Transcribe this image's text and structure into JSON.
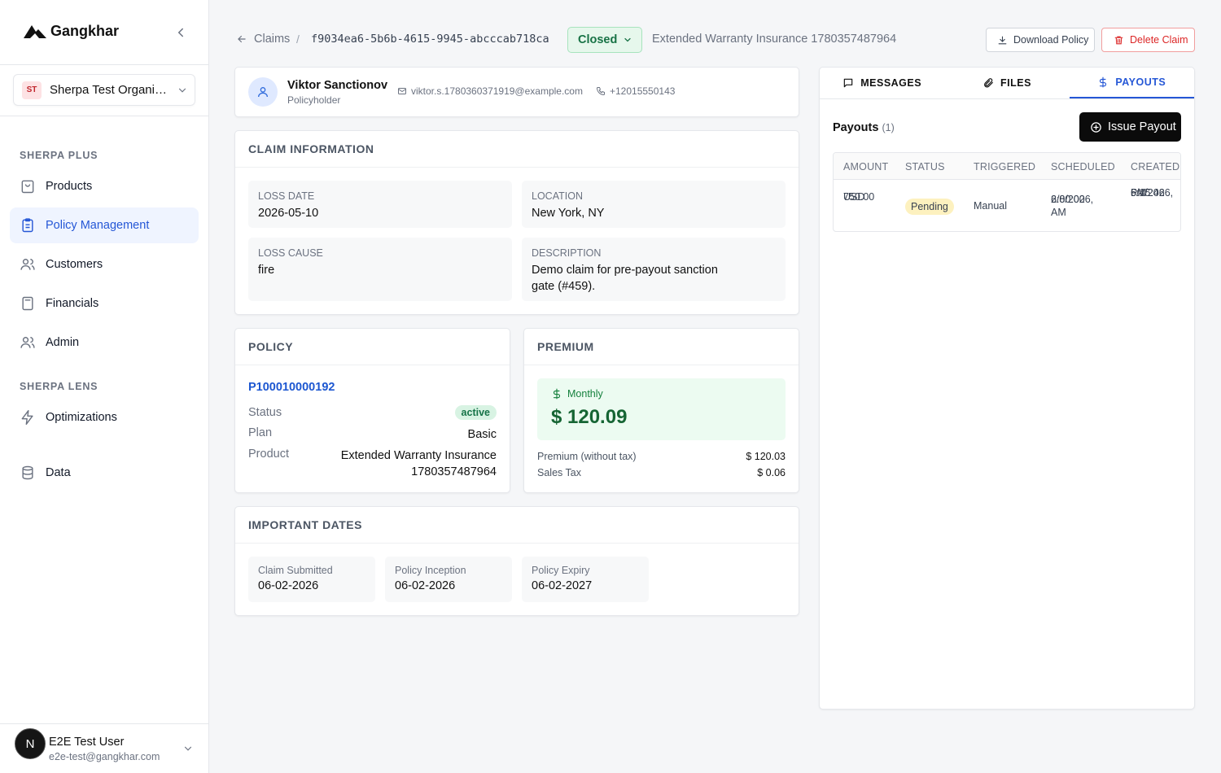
{
  "app": {
    "name": "Gangkhar"
  },
  "sidebar": {
    "org": {
      "initials": "ST",
      "name": "Sherpa Test Organization"
    },
    "sections": [
      {
        "title": "SHERPA PLUS"
      },
      {
        "title": "SHERPA LENS"
      }
    ],
    "items": [
      {
        "label": "Products"
      },
      {
        "label": "Policy Management"
      },
      {
        "label": "Customers"
      },
      {
        "label": "Financials"
      },
      {
        "label": "Admin"
      },
      {
        "label": "Optimizations"
      },
      {
        "label": "Data"
      }
    ],
    "user": {
      "initial": "N",
      "name": "E2E Test User",
      "email": "e2e-test@gangkhar.com"
    }
  },
  "header": {
    "breadcrumb": "Claims",
    "separator": "/",
    "claim_id": "f9034ea6-5b6b-4615-9945-abcccab718ca",
    "status": "Closed",
    "product": "Extended Warranty Insurance 1780357487964",
    "download_label": "Download Policy",
    "delete_label": "Delete Claim"
  },
  "policyholder": {
    "name": "Viktor Sanctionov",
    "role": "Policyholder",
    "email": "viktor.s.1780360371919@example.com",
    "phone": "+12015550143"
  },
  "claim_info": {
    "title": "CLAIM INFORMATION",
    "loss_date_label": "LOSS DATE",
    "loss_date": "2026-05-10",
    "location_label": "LOCATION",
    "location": "New York, NY",
    "loss_cause_label": "LOSS CAUSE",
    "loss_cause": "fire",
    "description_label": "DESCRIPTION",
    "description": "Demo claim for pre-payout sanction gate (#459)."
  },
  "policy": {
    "title": "POLICY",
    "number": "P100010000192",
    "status_label": "Status",
    "status": "active",
    "plan_label": "Plan",
    "plan": "Basic",
    "product_label": "Product",
    "product_line1": "Extended Warranty Insurance",
    "product_line2": "1780357487964"
  },
  "premium": {
    "title": "PREMIUM",
    "frequency": "Monthly",
    "amount": "$ 120.09",
    "without_tax_label": "Premium (without tax)",
    "without_tax": "$ 120.03",
    "tax_label": "Sales Tax",
    "tax": "$ 0.06"
  },
  "dates": {
    "title": "IMPORTANT DATES",
    "items": [
      {
        "label": "Claim Submitted",
        "value": "06-02-2026"
      },
      {
        "label": "Policy Inception",
        "value": "06-02-2026"
      },
      {
        "label": "Policy Expiry",
        "value": "06-02-2027"
      }
    ]
  },
  "panel": {
    "tabs": [
      {
        "label": "MESSAGES"
      },
      {
        "label": "FILES"
      },
      {
        "label": "PAYOUTS"
      }
    ],
    "payouts_title": "Payouts",
    "payouts_count": "(1)",
    "issue_label": "Issue Payout",
    "columns": [
      "AMOUNT",
      "STATUS",
      "TRIGGERED",
      "SCHEDULED",
      "CREATED"
    ],
    "rows": [
      {
        "amount_value": "750.00",
        "amount_currency": "USD",
        "status": "Pending",
        "triggered": "Manual",
        "scheduled_date": "6/8/2026,",
        "scheduled_time": "2:00:00 AM",
        "created_date": "6/1/2026,",
        "created_time": "5:45:46",
        "created_ampm": "PM"
      }
    ]
  },
  "colors": {
    "accent": "#2557d6",
    "success": "#157347",
    "danger": "#dc2626"
  }
}
